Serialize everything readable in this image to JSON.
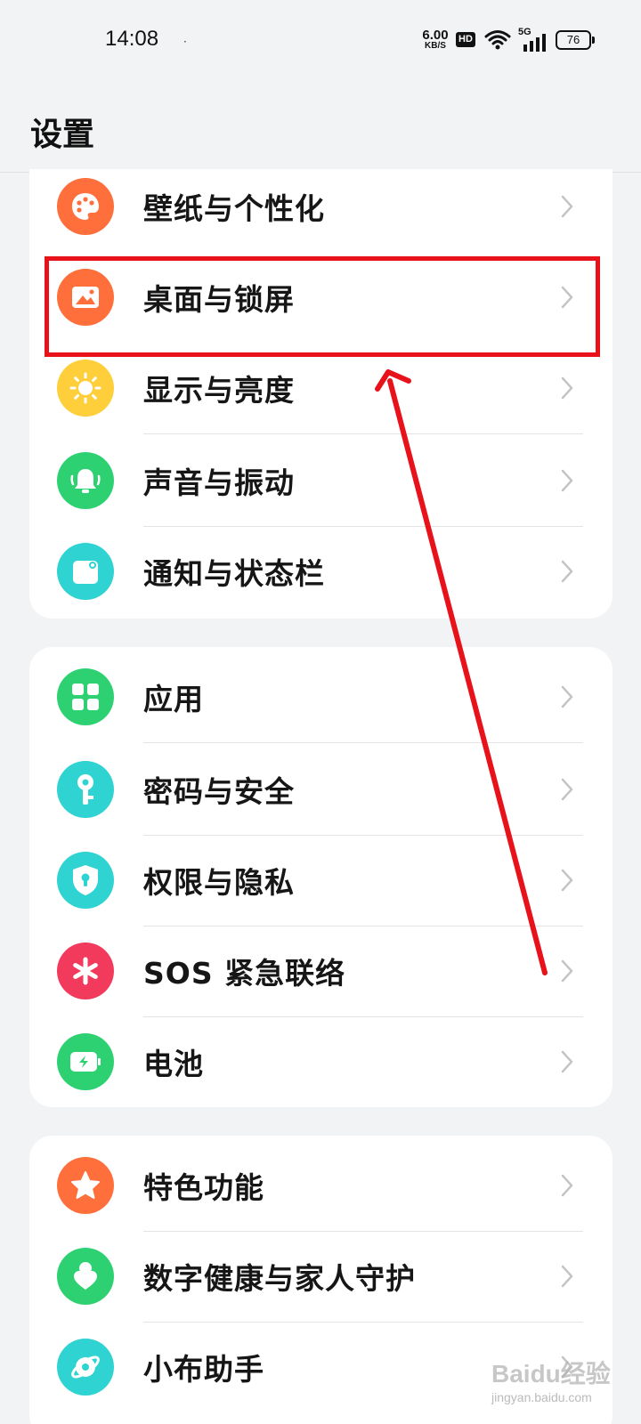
{
  "status_bar": {
    "time": "14:08",
    "dot": "·",
    "net_speed": "6.00",
    "net_unit": "KB/S",
    "hd": "HD",
    "signal_label": "5G",
    "battery": "76"
  },
  "header": {
    "title": "设置"
  },
  "groups": [
    {
      "items": [
        {
          "label": "壁纸与个性化",
          "icon": "palette-icon",
          "color": "#ff6f3c"
        },
        {
          "label": "桌面与锁屏",
          "icon": "picture-icon",
          "color": "#ff6f3c"
        },
        {
          "label": "显示与亮度",
          "icon": "sun-icon",
          "color": "#ffce3b"
        },
        {
          "label": "声音与振动",
          "icon": "bell-icon",
          "color": "#2dd172"
        },
        {
          "label": "通知与状态栏",
          "icon": "notification-icon",
          "color": "#2fd3d2"
        }
      ]
    },
    {
      "items": [
        {
          "label": "应用",
          "icon": "apps-grid-icon",
          "color": "#2dd172"
        },
        {
          "label": "密码与安全",
          "icon": "key-icon",
          "color": "#2fd3d2"
        },
        {
          "label": "权限与隐私",
          "icon": "shield-lock-icon",
          "color": "#2fd3d2"
        },
        {
          "label": "SOS 紧急联络",
          "icon": "asterisk-icon",
          "color": "#f23b5c"
        },
        {
          "label": "电池",
          "icon": "battery-charge-icon",
          "color": "#2dd172"
        }
      ]
    },
    {
      "items": [
        {
          "label": "特色功能",
          "icon": "star-icon",
          "color": "#ff6f3c"
        },
        {
          "label": "数字健康与家人守护",
          "icon": "person-heart-icon",
          "color": "#2dd172"
        },
        {
          "label": "小布助手",
          "icon": "assistant-icon",
          "color": "#2fd3d2"
        }
      ]
    }
  ],
  "annotation": {
    "highlight_color": "#e8121a"
  },
  "watermark": {
    "text": "Baidu经验",
    "sub": "jingyan.baidu.com"
  }
}
